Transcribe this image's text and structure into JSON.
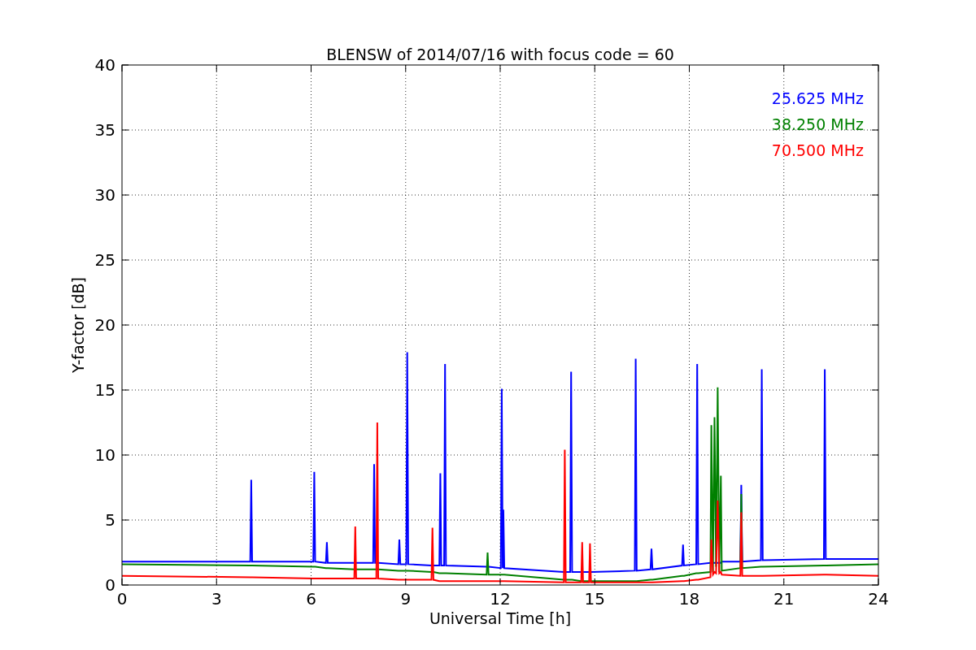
{
  "chart": {
    "chart_data": {
      "type": "line",
      "title": "BLENSW of 2014/07/16 with focus code = 60",
      "xlabel": "Universal Time [h]",
      "ylabel": "Y-factor [dB]",
      "grid": true,
      "xlim": [
        0,
        24
      ],
      "ylim": [
        0,
        40
      ],
      "xticks": [
        0,
        3,
        6,
        9,
        12,
        15,
        18,
        21,
        24
      ],
      "yticks": [
        0,
        5,
        10,
        15,
        20,
        25,
        30,
        35,
        40
      ],
      "x": [
        0,
        4.07,
        4.1,
        4.13,
        6.07,
        6.1,
        6.13,
        6.47,
        6.5,
        6.53,
        7.37,
        7.4,
        7.43,
        7.97,
        8.0,
        8.03,
        8.07,
        8.1,
        8.13,
        8.77,
        8.8,
        8.83,
        9.02,
        9.05,
        9.08,
        9.82,
        9.85,
        9.88,
        10.07,
        10.1,
        10.13,
        10.22,
        10.25,
        10.28,
        11.57,
        11.6,
        11.63,
        12.02,
        12.05,
        12.08,
        12.1,
        12.13,
        14.02,
        14.05,
        14.08,
        14.22,
        14.25,
        14.28,
        14.57,
        14.6,
        14.63,
        14.82,
        14.85,
        14.88,
        16.27,
        16.3,
        16.33,
        16.77,
        16.8,
        16.83,
        17.77,
        17.8,
        17.83,
        18.22,
        18.25,
        18.28,
        18.67,
        18.7,
        18.75,
        18.8,
        18.85,
        18.9,
        18.95,
        19.0,
        19.03,
        19.62,
        19.65,
        19.68,
        20.27,
        20.3,
        20.33,
        22.27,
        22.3,
        22.33,
        24
      ],
      "series": [
        {
          "name": "25.625 MHz",
          "color": "#0000ff",
          "values": [
            1.8,
            1.8,
            8.1,
            1.8,
            1.8,
            8.7,
            1.8,
            1.7,
            3.3,
            1.7,
            1.7,
            1.7,
            1.7,
            1.7,
            9.3,
            1.7,
            1.7,
            1.7,
            1.7,
            1.6,
            3.5,
            1.6,
            1.6,
            17.9,
            1.6,
            1.5,
            1.5,
            1.5,
            1.5,
            8.6,
            1.5,
            1.5,
            17.0,
            1.5,
            1.4,
            1.4,
            1.4,
            1.3,
            15.1,
            1.3,
            5.8,
            1.3,
            1.0,
            1.0,
            1.0,
            1.0,
            16.4,
            1.0,
            1.0,
            1.0,
            1.0,
            1.0,
            1.0,
            1.0,
            1.1,
            17.4,
            1.1,
            1.2,
            2.8,
            1.2,
            1.5,
            3.1,
            1.5,
            1.6,
            17.0,
            1.6,
            1.7,
            1.7,
            1.7,
            1.7,
            1.7,
            1.7,
            1.7,
            1.7,
            1.8,
            1.8,
            7.7,
            1.8,
            1.9,
            16.6,
            1.9,
            2.0,
            16.6,
            2.0,
            2.0
          ]
        },
        {
          "name": "38.250 MHz",
          "color": "#008000",
          "values": [
            1.6,
            1.5,
            1.5,
            1.5,
            1.4,
            1.4,
            1.4,
            1.3,
            1.3,
            1.3,
            1.2,
            1.2,
            1.2,
            1.2,
            1.2,
            1.2,
            1.2,
            1.2,
            1.2,
            1.1,
            1.1,
            1.1,
            1.1,
            1.1,
            1.1,
            1.0,
            1.0,
            1.0,
            0.9,
            0.9,
            0.9,
            0.9,
            0.9,
            0.9,
            0.8,
            2.5,
            0.8,
            0.8,
            0.8,
            0.8,
            0.8,
            0.8,
            0.4,
            0.4,
            0.4,
            0.4,
            0.4,
            0.4,
            0.3,
            0.3,
            0.3,
            0.3,
            0.3,
            0.3,
            0.3,
            0.3,
            0.3,
            0.4,
            0.4,
            0.4,
            0.7,
            0.7,
            0.7,
            0.9,
            0.9,
            0.9,
            1.0,
            12.3,
            1.0,
            12.9,
            1.4,
            15.2,
            1.0,
            8.4,
            1.1,
            1.3,
            7.0,
            1.3,
            1.4,
            1.4,
            1.4,
            1.5,
            1.5,
            1.5,
            1.6
          ]
        },
        {
          "name": "70.500 MHz",
          "color": "#ff0000",
          "values": [
            0.7,
            0.6,
            0.6,
            0.6,
            0.5,
            0.5,
            0.5,
            0.5,
            0.5,
            0.5,
            0.5,
            4.5,
            0.5,
            0.5,
            0.5,
            0.5,
            0.5,
            12.5,
            0.5,
            0.4,
            0.4,
            0.4,
            0.4,
            0.4,
            0.4,
            0.4,
            4.4,
            0.4,
            0.3,
            0.3,
            0.3,
            0.3,
            0.3,
            0.3,
            0.3,
            0.3,
            0.3,
            0.3,
            0.3,
            0.3,
            0.3,
            0.3,
            0.2,
            10.4,
            0.2,
            0.2,
            0.2,
            0.2,
            0.2,
            3.3,
            0.2,
            0.2,
            3.2,
            0.2,
            0.2,
            0.2,
            0.2,
            0.2,
            0.2,
            0.2,
            0.3,
            0.3,
            0.3,
            0.4,
            0.4,
            0.4,
            0.6,
            3.5,
            0.8,
            1.0,
            0.9,
            6.5,
            0.9,
            1.0,
            0.8,
            0.7,
            5.6,
            0.7,
            0.7,
            0.7,
            0.7,
            0.8,
            0.8,
            0.8,
            0.7
          ]
        }
      ]
    }
  }
}
